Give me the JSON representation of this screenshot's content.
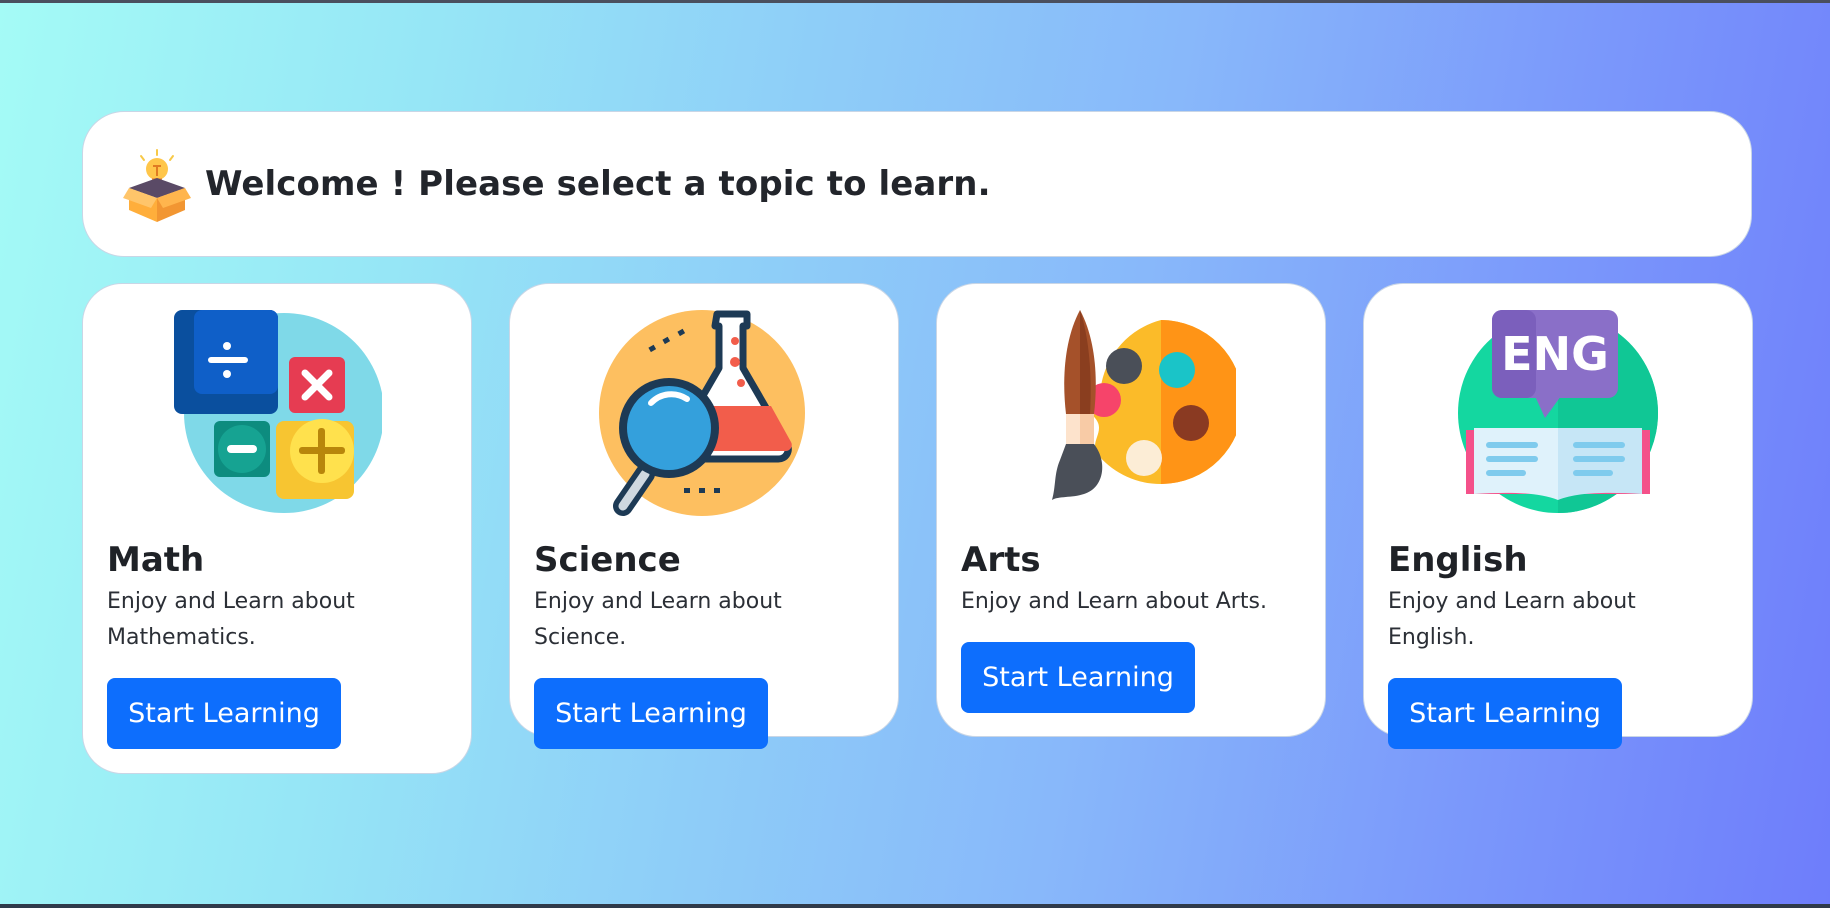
{
  "header": {
    "welcome_text": "Welcome ! Please select a topic to learn."
  },
  "topics": [
    {
      "title": "Math",
      "description": "Enjoy and Learn about Mathematics.",
      "button_label": "Start Learning",
      "icon": "math-icon"
    },
    {
      "title": "Science",
      "description": "Enjoy and Learn about Science.",
      "button_label": "Start Learning",
      "icon": "science-icon"
    },
    {
      "title": "Arts",
      "description": "Enjoy and Learn about Arts.",
      "button_label": "Start Learning",
      "icon": "arts-icon"
    },
    {
      "title": "English",
      "description": "Enjoy and Learn about English.",
      "button_label": "Start Learning",
      "icon": "english-icon"
    }
  ],
  "colors": {
    "button": "#0d6efd",
    "gradient_start": "#a4fbf6",
    "gradient_end": "#6e7dfb"
  }
}
